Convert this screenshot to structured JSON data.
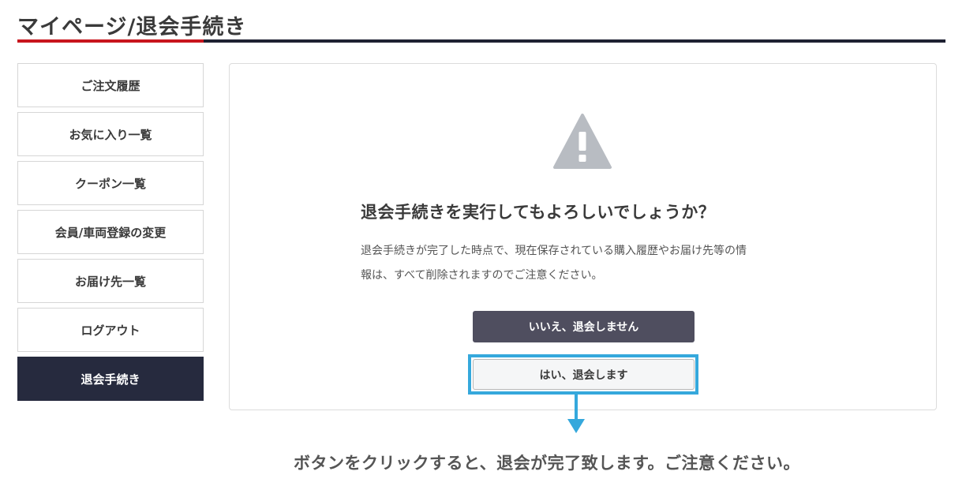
{
  "page": {
    "title": "マイページ/退会手続き"
  },
  "sidebar": {
    "items": [
      {
        "label": "ご注文履歴",
        "active": false
      },
      {
        "label": "お気に入り一覧",
        "active": false
      },
      {
        "label": "クーポン一覧",
        "active": false
      },
      {
        "label": "会員/車両登録の変更",
        "active": false
      },
      {
        "label": "お届け先一覧",
        "active": false
      },
      {
        "label": "ログアウト",
        "active": false
      },
      {
        "label": "退会手続き",
        "active": true
      }
    ]
  },
  "dialog": {
    "icon": "warning-triangle-icon",
    "heading": "退会手続きを実行してもよろしいでしょうか？",
    "body_line1": "退会手続きが完了した時点で、現在保存されている購入履歴やお届け先等の情",
    "body_line2": "報は、すべて削除されますのでご注意ください。",
    "cancel_label": "いいえ、退会しません",
    "confirm_label": "はい、退会します"
  },
  "annotation": {
    "text": "ボタンをクリックすると、退会が完了致します。ご注意ください。"
  },
  "colors": {
    "title_rule": "#1e2132",
    "title_accent": "#c8161d",
    "sidebar_active_bg": "#262a3e",
    "cancel_button_bg": "#4f4e5f",
    "highlight_border": "#35a8dc",
    "warning_icon": "#b8bcc2"
  }
}
